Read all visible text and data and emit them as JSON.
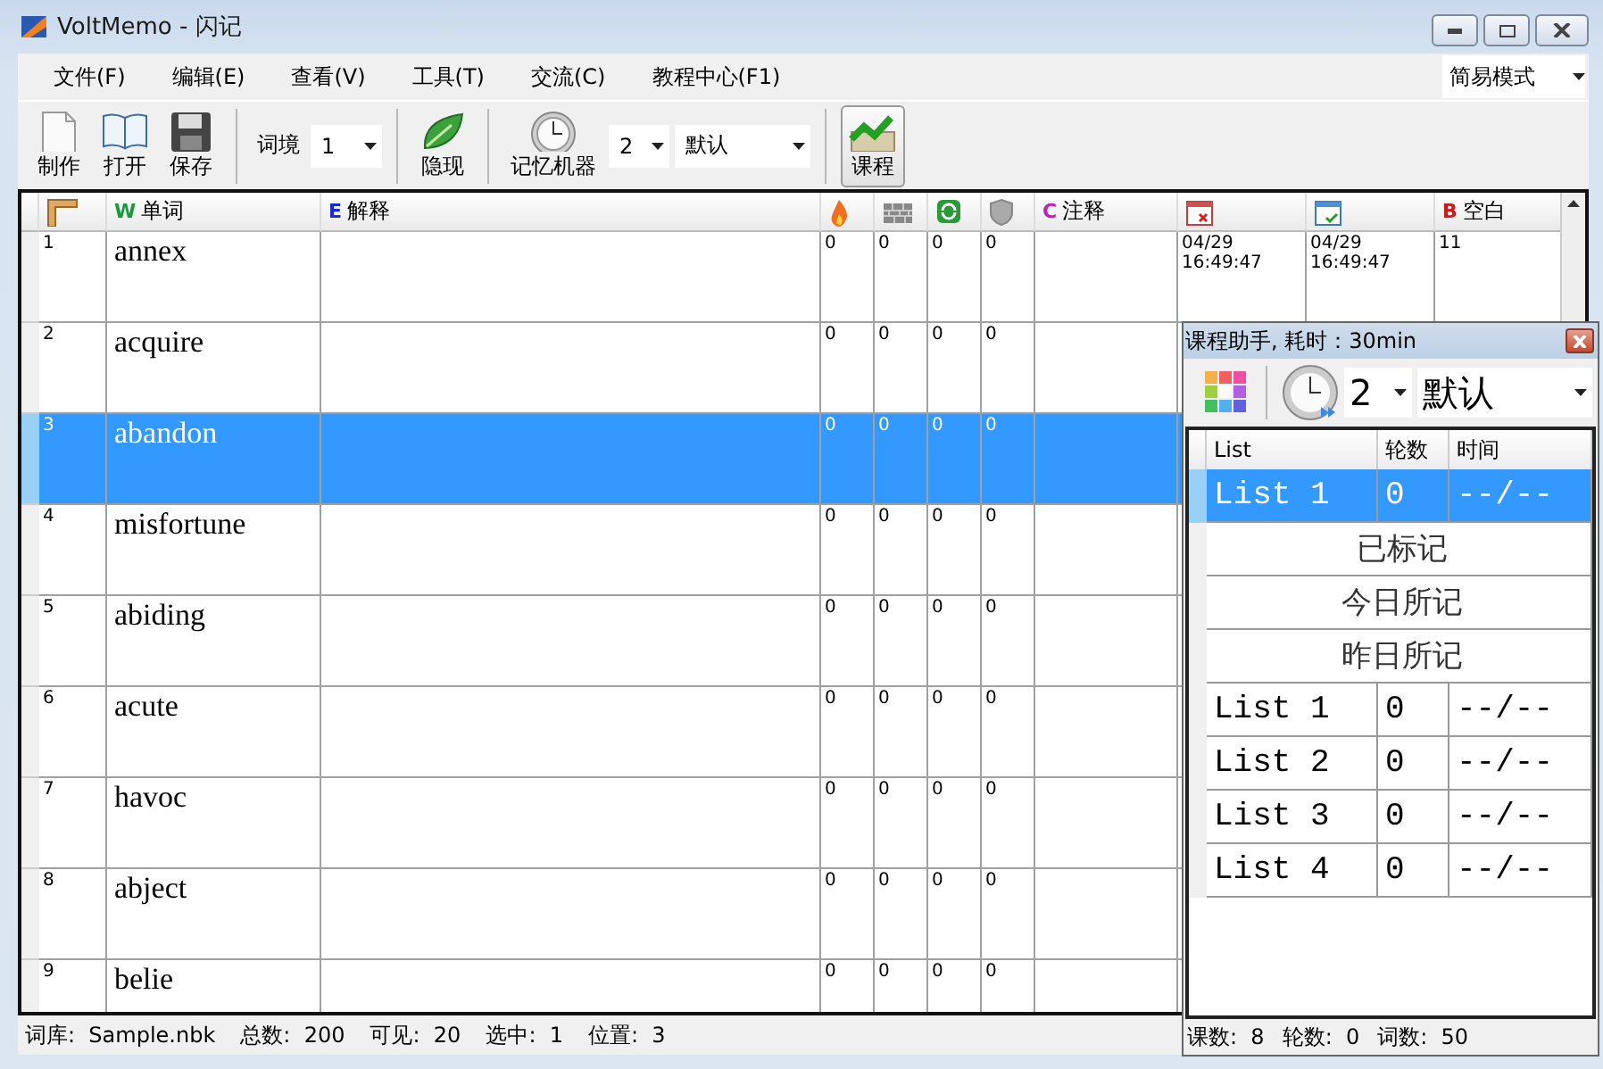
{
  "window": {
    "title": "VoltMemo - 闪记"
  },
  "menu": [
    "文件(F)",
    "编辑(E)",
    "查看(V)",
    "工具(T)",
    "交流(C)",
    "教程中心(F1)"
  ],
  "mode_select": {
    "value": "简易模式"
  },
  "toolbar": [
    {
      "kind": "button",
      "label": "制作",
      "pressed": false
    },
    {
      "kind": "button",
      "label": "打开",
      "pressed": false
    },
    {
      "kind": "button",
      "label": "保存",
      "pressed": false
    },
    {
      "kind": "separator"
    },
    {
      "kind": "label",
      "label": "词境"
    },
    {
      "kind": "select",
      "value": "1"
    },
    {
      "kind": "separator"
    },
    {
      "kind": "button",
      "label": "隐现",
      "pressed": false
    },
    {
      "kind": "separator"
    },
    {
      "kind": "button",
      "label": "记忆机器",
      "pressed": false
    },
    {
      "kind": "select",
      "value": "2"
    },
    {
      "kind": "select",
      "value": "默认"
    },
    {
      "kind": "separator"
    },
    {
      "kind": "button",
      "label": "课程",
      "pressed": true
    }
  ],
  "table": {
    "columns": [
      {
        "kind": "icon"
      },
      {
        "kind": "text",
        "badge": "W",
        "label": "单词"
      },
      {
        "kind": "text",
        "badge": "E",
        "label": "解释"
      },
      {
        "kind": "icon"
      },
      {
        "kind": "icon"
      },
      {
        "kind": "icon"
      },
      {
        "kind": "icon"
      },
      {
        "kind": "text",
        "badge": "C",
        "label": "注释"
      },
      {
        "kind": "icon"
      },
      {
        "kind": "icon"
      },
      {
        "kind": "text",
        "badge": "B",
        "label": "空白"
      }
    ],
    "rows": [
      {
        "num": "1",
        "word": "annex",
        "counts": [
          "0",
          "0",
          "0",
          "0"
        ],
        "dates": [
          "04/29\n16:49:47",
          "04/29\n16:49:47"
        ],
        "blank": "11",
        "selected": false
      },
      {
        "num": "2",
        "word": "acquire",
        "counts": [
          "0",
          "0",
          "0",
          "0"
        ],
        "selected": false
      },
      {
        "num": "3",
        "word": "abandon",
        "counts": [
          "0",
          "0",
          "0",
          "0"
        ],
        "selected": true
      },
      {
        "num": "4",
        "word": "misfortune",
        "counts": [
          "0",
          "0",
          "0",
          "0"
        ],
        "selected": false
      },
      {
        "num": "5",
        "word": "abiding",
        "counts": [
          "0",
          "0",
          "0",
          "0"
        ],
        "selected": false
      },
      {
        "num": "6",
        "word": "acute",
        "counts": [
          "0",
          "0",
          "0",
          "0"
        ],
        "selected": false
      },
      {
        "num": "7",
        "word": "havoc",
        "counts": [
          "0",
          "0",
          "0",
          "0"
        ],
        "selected": false
      },
      {
        "num": "8",
        "word": "abject",
        "counts": [
          "0",
          "0",
          "0",
          "0"
        ],
        "selected": false
      },
      {
        "num": "9",
        "word": "belie",
        "counts": [
          "0",
          "0",
          "0",
          "0"
        ],
        "selected": false
      }
    ]
  },
  "status_bar": [
    {
      "label": "词库:",
      "value": "Sample.nbk"
    },
    {
      "label": "总数:",
      "value": "200"
    },
    {
      "label": "可见:",
      "value": "20"
    },
    {
      "label": "选中:",
      "value": "1"
    },
    {
      "label": "位置:",
      "value": "3"
    }
  ],
  "course_panel": {
    "title": "课程助手, 耗时：30min",
    "round_select": "2",
    "mode_select": "默认",
    "columns": [
      "List",
      "轮数",
      "时间"
    ],
    "rows": [
      {
        "kind": "list",
        "name": "List 1",
        "rounds": "0",
        "time": "--/--",
        "selected": true
      },
      {
        "kind": "group",
        "name": "已标记",
        "selected": false
      },
      {
        "kind": "group",
        "name": "今日所记",
        "selected": false
      },
      {
        "kind": "group",
        "name": "昨日所记",
        "selected": false
      },
      {
        "kind": "list",
        "name": "List 1",
        "rounds": "0",
        "time": "--/--",
        "selected": false
      },
      {
        "kind": "list",
        "name": "List 2",
        "rounds": "0",
        "time": "--/--",
        "selected": false
      },
      {
        "kind": "list",
        "name": "List 3",
        "rounds": "0",
        "time": "--/--",
        "selected": false
      },
      {
        "kind": "list",
        "name": "List 4",
        "rounds": "0",
        "time": "--/--",
        "selected": false
      }
    ],
    "status": [
      {
        "label": "课数:",
        "value": "8"
      },
      {
        "label": "轮数:",
        "value": "0"
      },
      {
        "label": "词数:",
        "value": "50"
      }
    ]
  }
}
